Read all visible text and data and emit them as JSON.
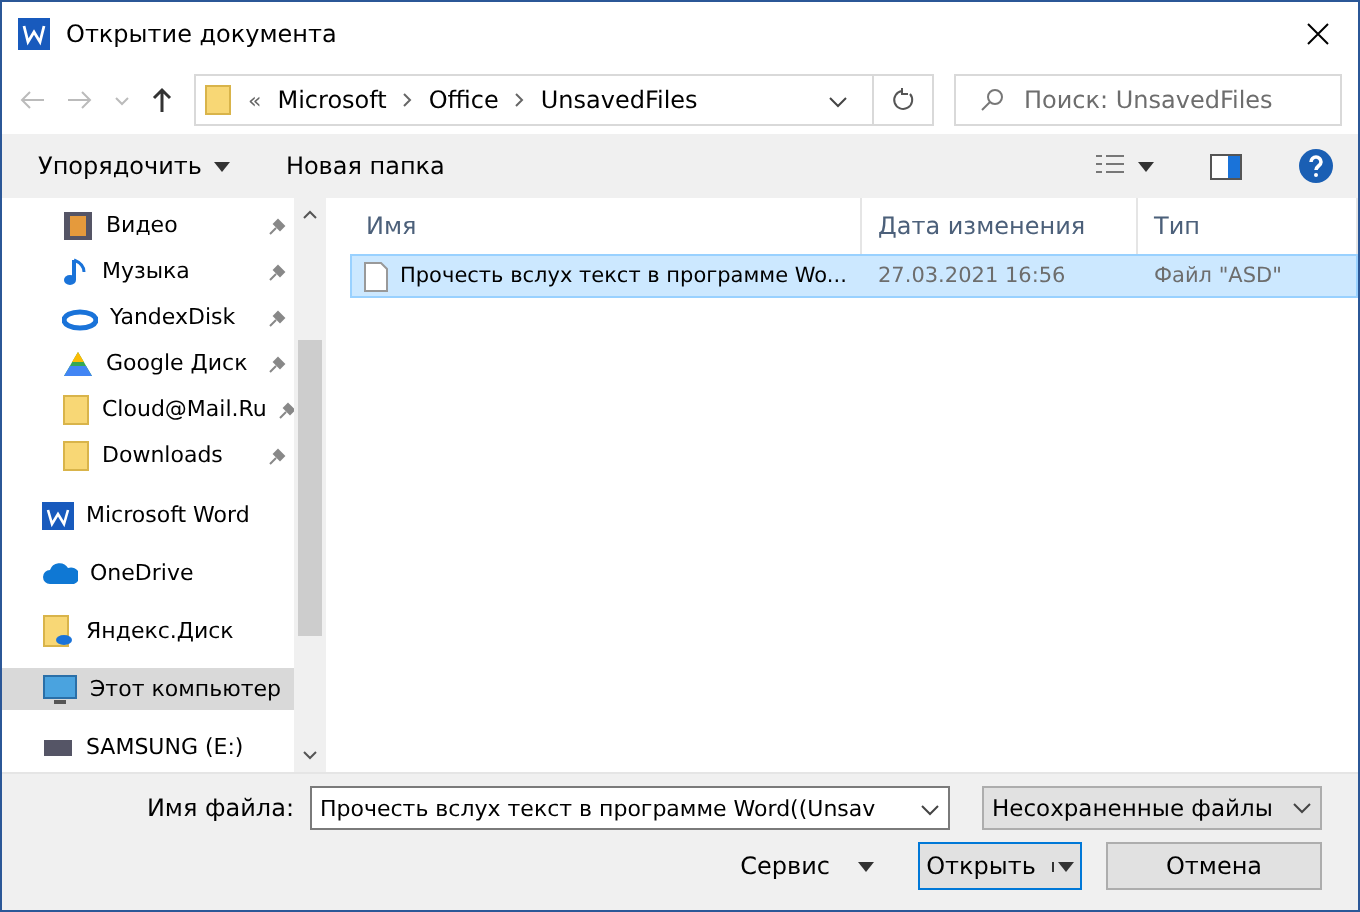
{
  "window": {
    "title": "Открытие документа"
  },
  "address": {
    "overflow": "«",
    "crumbs": [
      "Microsoft",
      "Office",
      "UnsavedFiles"
    ]
  },
  "search": {
    "placeholder": "Поиск: UnsavedFiles"
  },
  "toolbar": {
    "organize": "Упорядочить",
    "new_folder": "Новая папка"
  },
  "sidebar": {
    "items": [
      {
        "label": "Видео",
        "kind": "video",
        "pinned": true,
        "selected": false
      },
      {
        "label": "Музыка",
        "kind": "music",
        "pinned": true,
        "selected": false
      },
      {
        "label": "YandexDisk",
        "kind": "cloud",
        "pinned": true,
        "selected": false
      },
      {
        "label": "Google Диск",
        "kind": "drive",
        "pinned": true,
        "selected": false
      },
      {
        "label": "Cloud@Mail.Ru",
        "kind": "folder",
        "pinned": true,
        "selected": false
      },
      {
        "label": "Downloads",
        "kind": "folder",
        "pinned": true,
        "selected": false
      },
      {
        "label": "Microsoft Word",
        "kind": "word",
        "pinned": false,
        "selected": false
      },
      {
        "label": "OneDrive",
        "kind": "onedrive",
        "pinned": false,
        "selected": false
      },
      {
        "label": "Яндекс.Диск",
        "kind": "yfolder",
        "pinned": false,
        "selected": false
      },
      {
        "label": "Этот компьютер",
        "kind": "pc",
        "pinned": false,
        "selected": true
      },
      {
        "label": "SAMSUNG (E:)",
        "kind": "disk",
        "pinned": false,
        "selected": false
      }
    ]
  },
  "table": {
    "columns": [
      "Имя",
      "Дата изменения",
      "Тип"
    ],
    "rows": [
      {
        "name": "Прочесть вслух текст в программе Wo...",
        "date": "27.03.2021 16:56",
        "type": "Файл \"ASD\"",
        "selected": true
      }
    ]
  },
  "footer": {
    "filename_label": "Имя файла:",
    "filename": "Прочесть вслух текст в программе Word((Unsav",
    "filter": "Несохраненные файлы",
    "tools": "Сервис",
    "open": "Открыть",
    "cancel": "Отмена"
  }
}
